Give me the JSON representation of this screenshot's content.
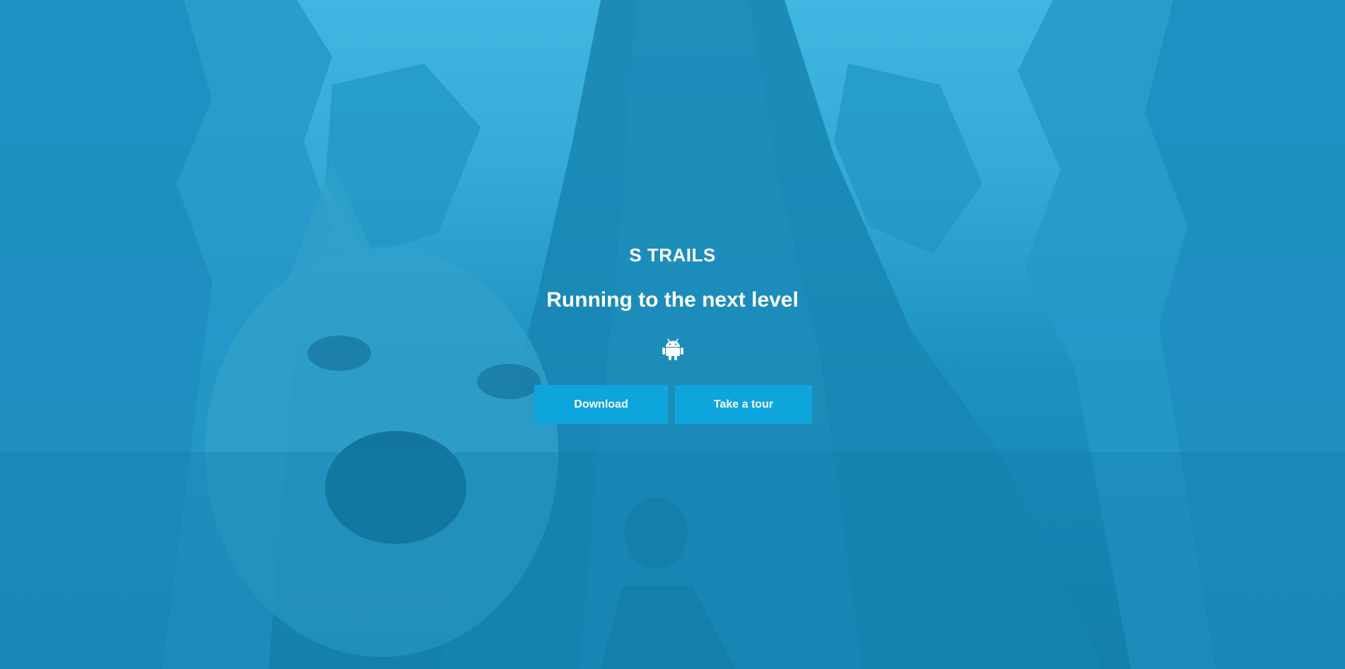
{
  "hero": {
    "brand": "S TRAILS",
    "tagline": "Running to the next level",
    "platform_icon": "android-icon",
    "download_label": "Download",
    "tour_label": "Take a tour"
  },
  "colors": {
    "sky": "#4cc0ea",
    "overlay": "#1a8bbb",
    "button": "#0ea5dd",
    "text": "#ffffff"
  }
}
